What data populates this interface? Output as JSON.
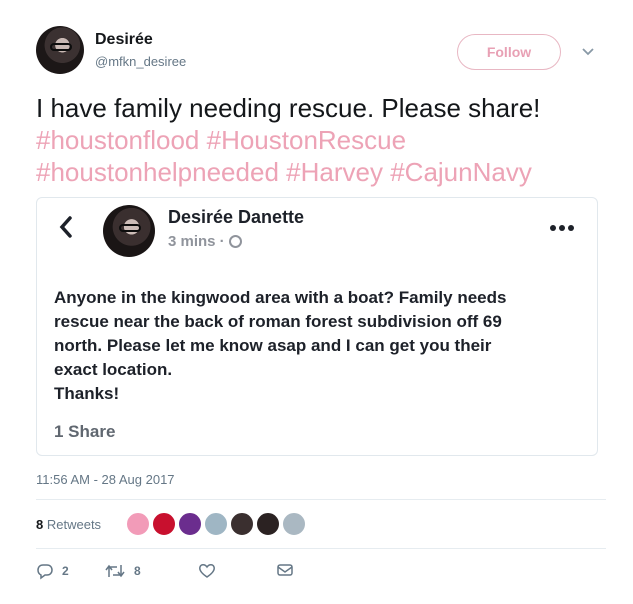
{
  "author": {
    "name": "Desirée",
    "handle": "@mfkn_desiree"
  },
  "follow_label": "Follow",
  "tweet": {
    "text": "I have family needing rescue. Please share!",
    "hashtags": [
      "#houstonflood",
      "#HoustonRescue",
      "#houstonhelpneeded",
      "#Harvey",
      "#CajunNavy"
    ]
  },
  "card": {
    "name": "Desirée Danette",
    "time": "3 mins ·",
    "post_lines": [
      "Anyone in the kingwood area with a boat? Family needs",
      "rescue near the back of roman forest subdivision off 69",
      "north. Please let me know asap and I can get you their",
      "exact location.",
      "Thanks!"
    ],
    "shares": "1 Share"
  },
  "timestamp": "11:56 AM - 28 Aug 2017",
  "retweets": {
    "count": "8",
    "label": "Retweets"
  },
  "retweeter_colors": [
    "#f29bb8",
    "#c8102e",
    "#6b2d8e",
    "#9fb6c4",
    "#3a2f2f",
    "#2b2222",
    "#aab8c2"
  ],
  "actions": {
    "replies": "2",
    "retweets": "8"
  },
  "colors": {
    "accent": "#eda3b6",
    "muted": "#657786"
  }
}
